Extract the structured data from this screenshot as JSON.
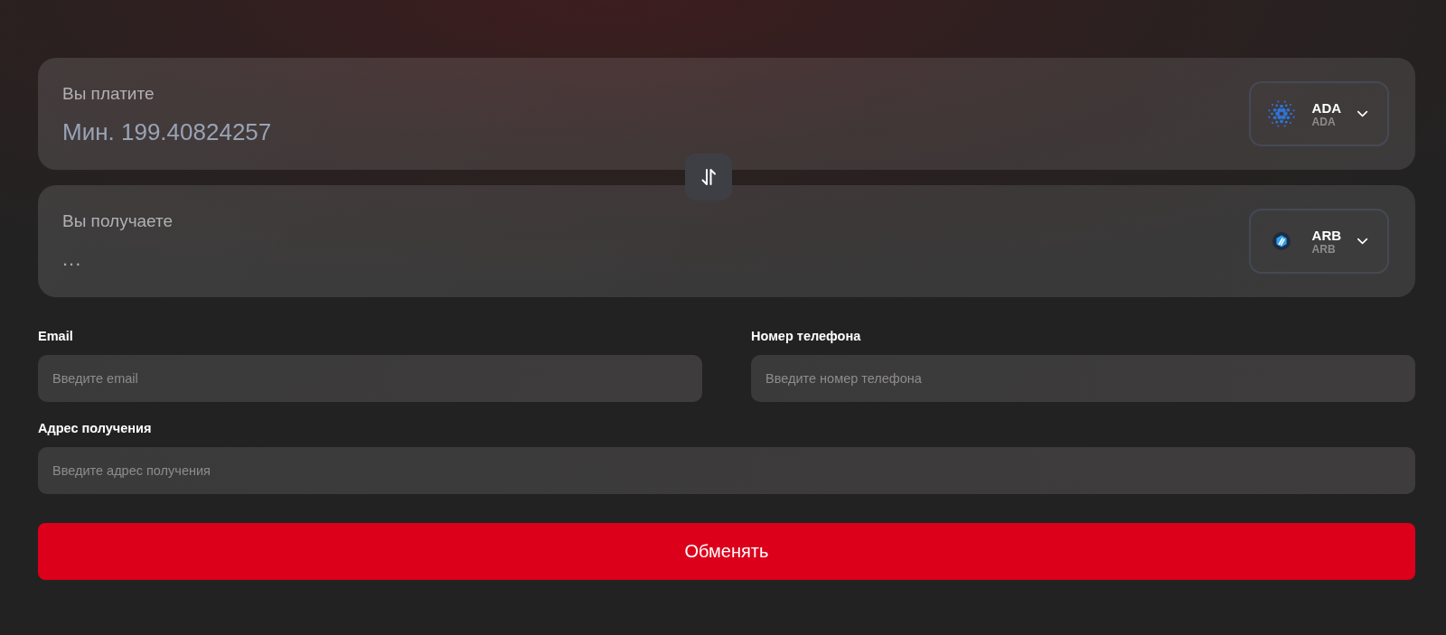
{
  "cards": [
    {
      "label": "Вы платите",
      "placeholder": "Мин. 199.40824257",
      "currency": {
        "kind": "dots",
        "code": "ADA",
        "name": "ADA"
      }
    },
    {
      "label": "Вы получаете",
      "value": "...",
      "currency": {
        "kind": "hexagon",
        "code": "ARB",
        "name": "ARB"
      }
    }
  ],
  "form": {
    "fields": [
      {
        "label": "Email",
        "placeholder": "Введите email"
      },
      {
        "label": "Номер телефона",
        "placeholder": "Введите номер телефона"
      },
      {
        "label": "Адрес получения",
        "placeholder": "Введите адрес получения"
      }
    ]
  },
  "submit_button": "Обменять"
}
